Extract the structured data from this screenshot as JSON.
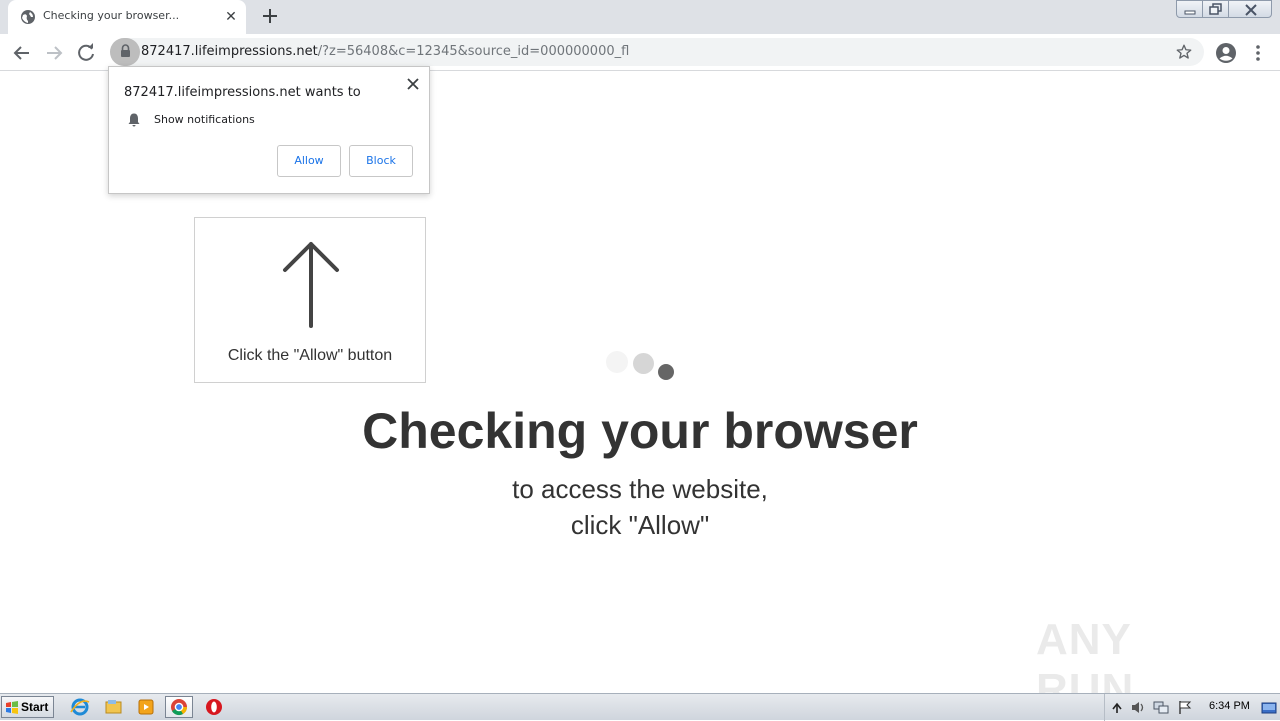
{
  "browser": {
    "tab": {
      "title": "Checking your browser...",
      "close_glyph": "✕",
      "favicon": "globe-icon"
    },
    "new_tab_icon": "plus-icon",
    "window_controls": [
      "minimize-icon",
      "restore-icon",
      "close-icon"
    ],
    "toolbar": {
      "back_icon": "arrow-left-icon",
      "forward_icon": "arrow-right-icon",
      "reload_icon": "reload-icon",
      "lock_icon": "lock-icon",
      "url_host": "872417.lifeimpressions.net",
      "url_path": "/?z=56408&c=12345&source_id=000000000_fl",
      "bookmark_icon": "star-icon",
      "profile_icon": "account-circle-icon",
      "menu_icon": "kebab-menu-icon"
    }
  },
  "permission_prompt": {
    "title": "872417.lifeimpressions.net wants to",
    "permission": "Show notifications",
    "permission_icon": "bell-icon",
    "allow_label": "Allow",
    "block_label": "Block",
    "close_icon": "close-icon"
  },
  "page": {
    "hint_text": "Click the \"Allow\" button",
    "hint_icon": "arrow-up-icon",
    "headline": "Checking your browser",
    "subline_1": "to access the website,",
    "subline_2": "click \"Allow\"",
    "loader_icon": "loading-dots-icon",
    "watermark_text": "ANY RUN"
  },
  "taskbar": {
    "start_label": "Start",
    "apps": [
      "internet-explorer-icon",
      "file-explorer-icon",
      "media-player-icon",
      "chrome-icon",
      "opera-icon"
    ],
    "tray_icons": [
      "show-hidden-icon",
      "volume-icon",
      "network-icon",
      "action-center-flag-icon",
      "show-desktop-icon"
    ],
    "clock": "6:34 PM"
  },
  "colors": {
    "tabstrip": "#dee1e6",
    "omnibox": "#f1f3f4",
    "link_blue": "#1a73e8",
    "headline": "#333333"
  }
}
